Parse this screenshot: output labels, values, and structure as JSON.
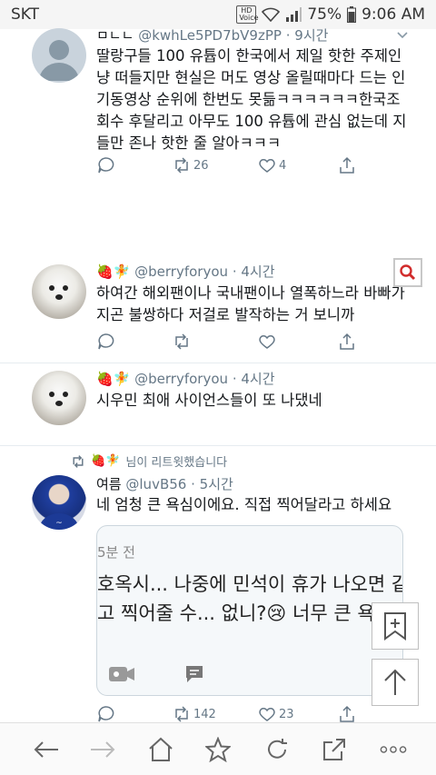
{
  "status_bar": {
    "carrier": "SKT",
    "hd_label": "HD Voice",
    "battery": "75%",
    "time": "9:06 AM"
  },
  "tweets": [
    {
      "name": "ㅁㄴㄴ",
      "handle": "@kwhLe5PD7bV9zPP",
      "time": "· 9시간",
      "lines": [
        "딸랑구들 100 유튭이 한국에서 제일 핫한 주제인",
        "냥 떠들지만 현실은 머도 영상 올릴때마다 드는 인",
        "기동영상 순위에 한번도 못듦ㅋㅋㅋㅋㅋㅋ한국조",
        "회수 후달리고 아무도 100 유튭에 관심 없는데 지",
        "들만 존나 핫한 줄 알아ㅋㅋㅋ"
      ],
      "retweets": "26",
      "likes": "4"
    },
    {
      "emoji": "🍓🧚",
      "handle": "@berryforyou",
      "time": "· 4시간",
      "lines": [
        "하여간 해외팬이나 국내팬이나 열폭하느라 바빠가",
        "지곤 불쌍하다 저걸로 발작하는 거 보니까"
      ],
      "retweets": "",
      "likes": ""
    },
    {
      "emoji": "🍓🧚",
      "handle": "@berryforyou",
      "time": "· 4시간",
      "lines": [
        "시우민 최애 사이언스들이 또 나댔네"
      ]
    },
    {
      "retweet_label": "님이 리트윗했습니다",
      "retweet_emoji": "🍓🧚",
      "name": "여름",
      "handle": "@luvB56",
      "time": "· 5시간",
      "lines": [
        "네 엄청 큰 욕심이에요. 직접 찍어달라고 하세요"
      ],
      "retweets": "142",
      "likes": "23",
      "quote": {
        "time": "5분 전",
        "line1": "호옥시... 나중에 민석이 휴가 나오면 같",
        "line2": "고 찍어줄 수... 없니?😢 너무 큰 욕심?"
      }
    }
  ]
}
